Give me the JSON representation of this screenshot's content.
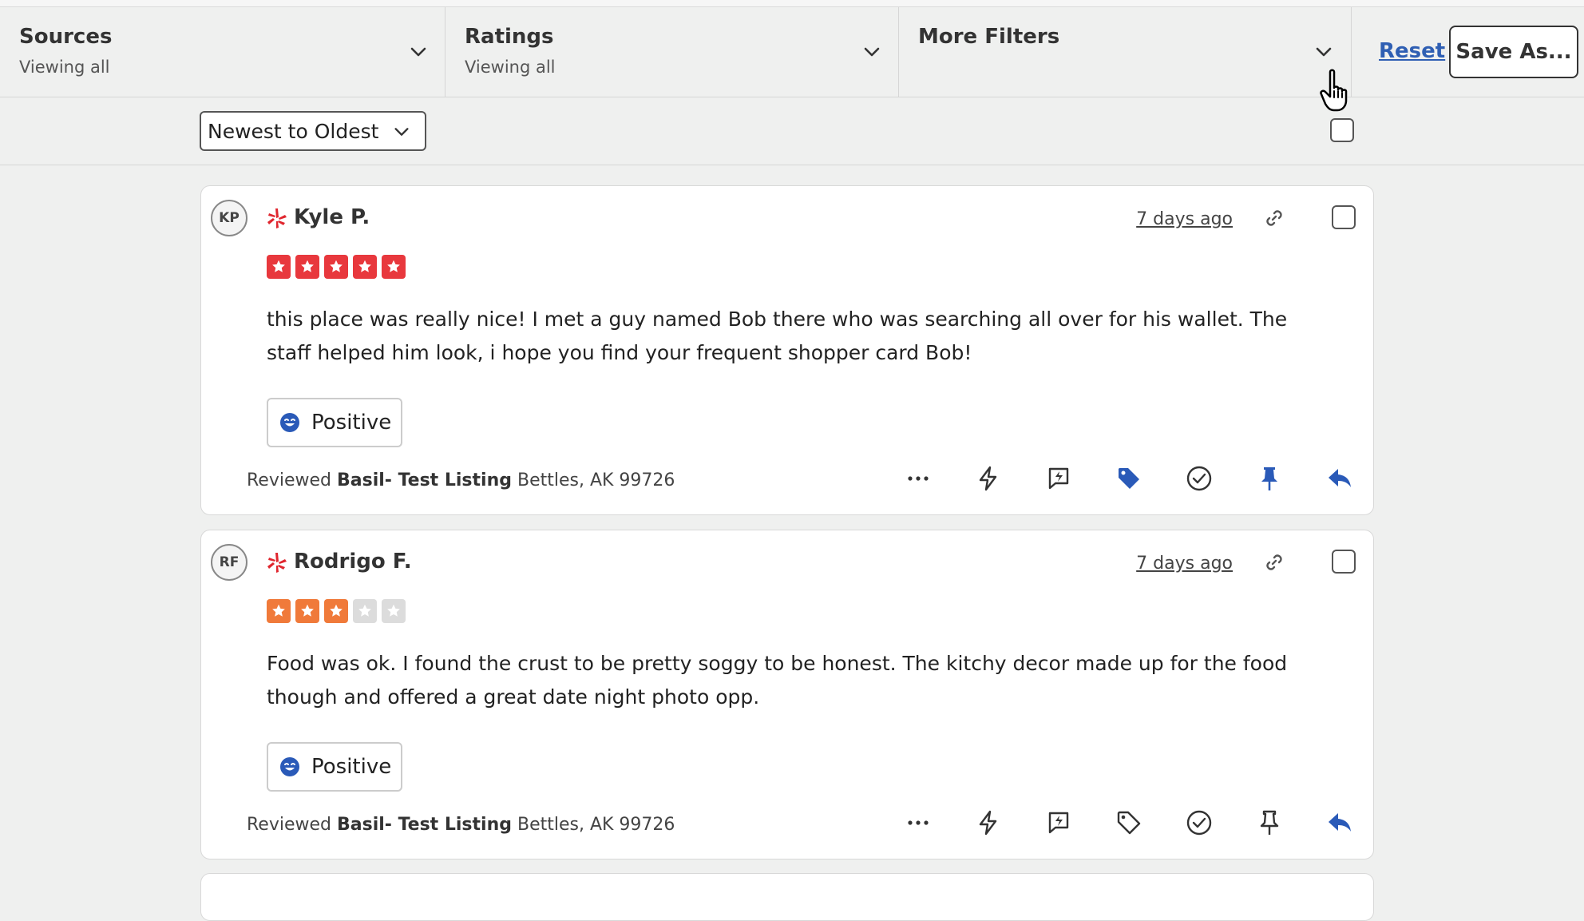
{
  "filters": {
    "sources": {
      "title": "Sources",
      "sub": "Viewing all"
    },
    "ratings": {
      "title": "Ratings",
      "sub": "Viewing all"
    },
    "more": {
      "title": "More Filters"
    },
    "reset_label": "Reset",
    "save_label": "Save As..."
  },
  "sort": {
    "selected": "Newest to Oldest"
  },
  "reviews": [
    {
      "initials": "KP",
      "name": "Kyle P.",
      "date": "7 days ago",
      "rating": 5,
      "text": "this place was really nice! I met a guy named Bob there who was searching all over for his wallet. The staff helped him look, i hope you find your frequent shopper card Bob!",
      "sentiment": "Positive",
      "reviewed_prefix": "Reviewed",
      "listing": "Basil- Test Listing",
      "location": "Bettles, AK 99726"
    },
    {
      "initials": "RF",
      "name": "Rodrigo F.",
      "date": "7 days ago",
      "rating": 3,
      "text": "Food was ok. I found the crust to be pretty soggy to be honest. The kitchy decor made up for the food though and offered a great date night photo opp.",
      "sentiment": "Positive",
      "reviewed_prefix": "Reviewed",
      "listing": "Basil- Test Listing",
      "location": "Bettles, AK 99726"
    }
  ],
  "colors": {
    "star_five": "#e8383d",
    "star_three": "#f07a3a",
    "star_empty": "#dcdcdc",
    "accent_blue": "#2a5ab8",
    "yelp_red": "#e0262e"
  },
  "icons": [
    "chevron-down-icon",
    "hand-cursor-icon",
    "yelp-icon",
    "link-icon",
    "star-icon",
    "smiley-icon",
    "more-icon",
    "lightning-icon",
    "quick-reply-icon",
    "tag-icon",
    "check-circle-icon",
    "pin-icon",
    "reply-icon"
  ]
}
